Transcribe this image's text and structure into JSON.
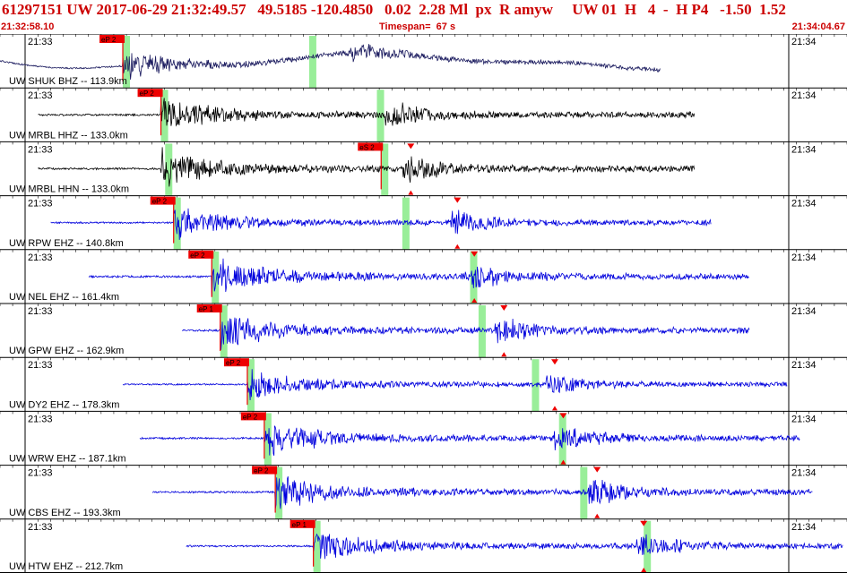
{
  "header": {
    "event_line": "61297151 UW 2017-06-29 21:32:49.57   49.5185 -120.4850   0.02  2.28 Ml  px  R amyw     UW 01  H   4  -  H P4   -1.50  1.52",
    "start_time": "21:32:58.10",
    "timespan": "Timespan=  67 s",
    "end_time": "21:34:04.67"
  },
  "colors": {
    "title": "#cc0000",
    "pick_box": "#ee0000",
    "pick_window": "#99ee99",
    "trace_dark": "#1a1a5e",
    "trace_black": "#000000",
    "trace_blue": "#0000dd",
    "grid": "#000000"
  },
  "time_labels": {
    "left": "21:33",
    "right": "21:34"
  },
  "traces": [
    {
      "label": "UW SHUK BHZ -- 113.9km",
      "pick": "eP 2",
      "pick_t": 0.145,
      "second_window_t": 0.365,
      "start": 0.0,
      "end": 0.78,
      "onset": 0.145,
      "amp": 0.95,
      "color": "dark",
      "s_marker_t": null,
      "lp": true
    },
    {
      "label": "UW MRBL HHZ -- 133.0km",
      "pick": "eP 2",
      "pick_t": 0.19,
      "second_window_t": 0.445,
      "start": 0.045,
      "end": 0.82,
      "onset": 0.19,
      "amp": 0.85,
      "color": "black",
      "s_marker_t": null
    },
    {
      "label": "UW MRBL HHN -- 133.0km",
      "pick": "eS 2",
      "pick_t": 0.45,
      "second_window_t": 0.195,
      "start": 0.045,
      "end": 0.82,
      "onset": 0.19,
      "amp": 0.9,
      "color": "black",
      "s_marker_t": 0.485
    },
    {
      "label": "UW RPW EHZ -- 140.8km",
      "pick": "eP 2",
      "pick_t": 0.205,
      "second_window_t": 0.475,
      "start": 0.06,
      "end": 0.84,
      "onset": 0.205,
      "amp": 0.75,
      "color": "blue",
      "s_marker_t": 0.54
    },
    {
      "label": "UW NEL EHZ -- 161.4km",
      "pick": "eP 2",
      "pick_t": 0.25,
      "second_window_t": 0.555,
      "start": 0.105,
      "end": 0.885,
      "onset": 0.25,
      "amp": 0.9,
      "color": "blue",
      "s_marker_t": 0.56
    },
    {
      "label": "UW GPW EHZ -- 162.9km",
      "pick": "eP 1",
      "pick_t": 0.26,
      "second_window_t": 0.565,
      "start": 0.215,
      "end": 0.885,
      "onset": 0.26,
      "amp": 0.85,
      "color": "blue",
      "s_marker_t": 0.595
    },
    {
      "label": "UW DY2 EHZ -- 178.3km",
      "pick": "eP 2",
      "pick_t": 0.292,
      "second_window_t": 0.628,
      "start": 0.145,
      "end": 0.93,
      "onset": 0.292,
      "amp": 0.7,
      "color": "blue",
      "s_marker_t": 0.655
    },
    {
      "label": "UW WRW EHZ -- 187.1km",
      "pick": "eP 2",
      "pick_t": 0.312,
      "second_window_t": 0.66,
      "start": 0.165,
      "end": 0.945,
      "onset": 0.312,
      "amp": 0.85,
      "color": "blue",
      "s_marker_t": 0.665
    },
    {
      "label": "UW CBS EHZ -- 193.3km",
      "pick": "eP 2",
      "pick_t": 0.325,
      "second_window_t": 0.685,
      "start": 0.18,
      "end": 0.96,
      "onset": 0.325,
      "amp": 0.85,
      "color": "blue",
      "s_marker_t": 0.705
    },
    {
      "label": "UW HTW EHZ -- 212.7km",
      "pick": "eP 1",
      "pick_t": 0.37,
      "second_window_t": 0.76,
      "start": 0.22,
      "end": 0.995,
      "onset": 0.37,
      "amp": 0.8,
      "color": "blue",
      "s_marker_t": 0.76
    }
  ]
}
